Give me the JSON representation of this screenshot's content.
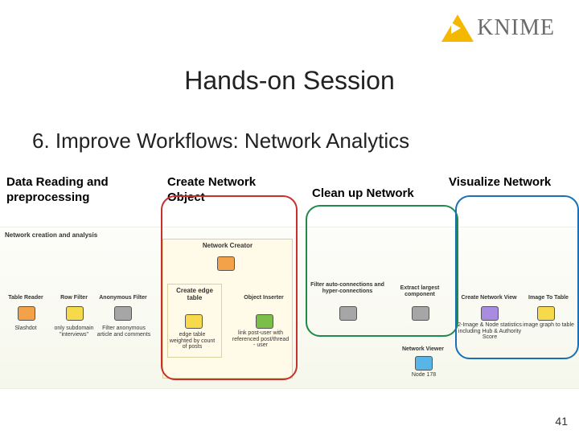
{
  "brand": {
    "name": "KNIME"
  },
  "title": "Hands-on Session",
  "subtitle": "6. Improve Workflows: Network Analytics",
  "phases": {
    "p1": "Data Reading and preprocessing",
    "p2": "Create Network Object",
    "p3": "Clean up Network",
    "p4": "Visualize Network"
  },
  "workflow": {
    "frame_label": "Network creation and analysis",
    "creator_label": "Network Creator",
    "nodes": {
      "n1": "Table Reader",
      "n2": "Row Filter",
      "n3": "Anonymous Filter",
      "n4": "Create edge table",
      "n5": "Object Inserter",
      "n6": "Filter auto-connections and hyper-connections",
      "n7": "Extract largest component",
      "n8": "Create Network View",
      "n9": "Image To Table",
      "n10": "Network Viewer"
    },
    "subcaps": {
      "c1": "Slashdot",
      "c2": "only subdomain \"interviews\"",
      "c3": "Filter anonymous article and comments",
      "c4": "edge table weighted by count of posts",
      "c5": "link post-user with referenced post/thread - user",
      "c8": "2-Image & Node statistics including Hub & Authority Score",
      "c9": "image graph to table",
      "c10": "Node 178"
    }
  },
  "page_number": "41"
}
